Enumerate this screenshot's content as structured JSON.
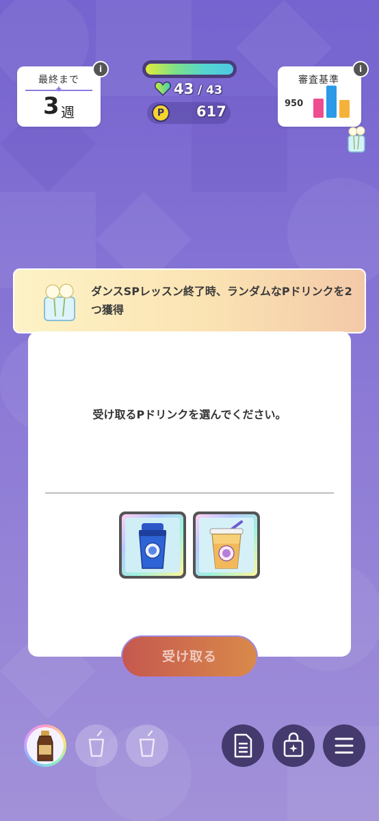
{
  "header": {
    "weeks_label": "最終まで",
    "weeks_value": "3",
    "weeks_unit": "週",
    "stamina_current": "43",
    "stamina_sep": "/",
    "stamina_max": "43",
    "p_icon_letter": "P",
    "p_points": "617",
    "audit_label": "審査基準",
    "audit_value": "950",
    "audit_bars": [
      0.55,
      1.0,
      0.55
    ],
    "info_symbol": "i"
  },
  "banner": {
    "text": "ダンスSPレッスン終了時、ランダムなPドリンクを2つ獲得"
  },
  "dialog": {
    "prompt": "受け取るPドリンクを選んでください。",
    "drinks": [
      {
        "icon": "blue-shaker-bottle-icon"
      },
      {
        "icon": "iced-drink-cup-icon"
      }
    ],
    "receive_label": "受け取る"
  },
  "colors": {
    "background": "#7a68d0",
    "accent": "#8b7be0",
    "button": "#c5584f",
    "bar_pink": "#ee4d8f",
    "bar_blue": "#2b9be8",
    "bar_orange": "#f5b23a"
  },
  "bottom_bar": {
    "drink_slots": [
      "brown-bottle-drink-icon",
      "empty-cup-icon",
      "empty-cup-icon"
    ],
    "buttons": [
      "memo-icon",
      "gift-bag-icon",
      "menu-icon"
    ]
  }
}
